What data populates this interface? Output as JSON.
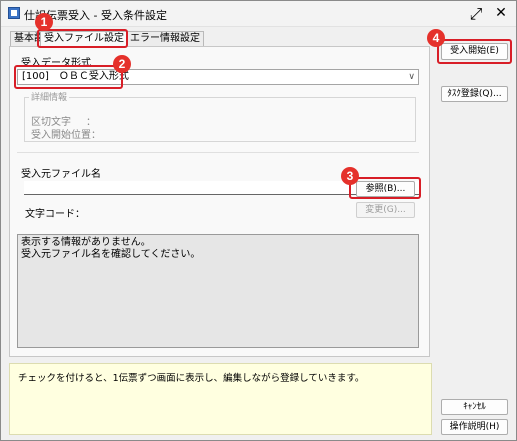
{
  "window": {
    "title": "仕訳伝票受入 - 受入条件設定"
  },
  "tabs": [
    {
      "label": "基本設定"
    },
    {
      "label": "受入ファイル設定"
    },
    {
      "label": "エラー情報設定"
    }
  ],
  "format": {
    "label": "受入データ形式",
    "selected": "[100]　ＯＢＣ受入形式"
  },
  "details": {
    "title": "詳細情報",
    "delimiter_label": "区切文字",
    "start_pos_label": "受入開始位置：",
    "colon": "："
  },
  "source": {
    "label": "受入元ファイル名",
    "value": "",
    "browse_button": "参照(B)...",
    "charset_label": "文字コード：",
    "change_button": "変更(G)..."
  },
  "messages": [
    "表示する情報がありません。",
    "受入元ファイル名を確認してください。"
  ],
  "hint": "チェックを付けると、1伝票ずつ画面に表示し、編集しながら登録していきます。",
  "buttons": {
    "start": "受入開始(E)",
    "task_register": "ﾀｽｸ登録(Q)...",
    "cancel": "ｷｬﾝｾﾙ",
    "help": "操作説明(H)"
  },
  "callouts": [
    "1",
    "2",
    "3",
    "4"
  ],
  "colors": {
    "callout": "#d81e27",
    "hint_bg": "#ffffe0"
  }
}
